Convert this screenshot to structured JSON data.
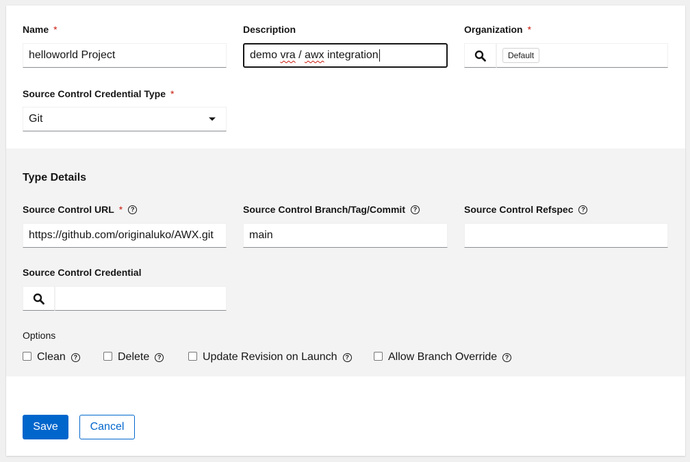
{
  "form": {
    "name": {
      "label": "Name",
      "required": "*",
      "value": "helloworld Project"
    },
    "description": {
      "label": "Description",
      "value_parts": [
        "demo ",
        "vra",
        " / ",
        "awx",
        " integration"
      ]
    },
    "organization": {
      "label": "Organization",
      "required": "*",
      "chip": "Default"
    },
    "credential_type": {
      "label": "Source Control Credential Type",
      "required": "*",
      "value": "Git"
    }
  },
  "type_details": {
    "title": "Type Details",
    "url": {
      "label": "Source Control URL",
      "required": "*",
      "value": "https://github.com/originaluko/AWX.git"
    },
    "branch": {
      "label": "Source Control Branch/Tag/Commit",
      "value": "main"
    },
    "refspec": {
      "label": "Source Control Refspec",
      "value": ""
    },
    "credential": {
      "label": "Source Control Credential",
      "value": ""
    },
    "options": {
      "label": "Options",
      "items": [
        {
          "label": "Clean",
          "checked": false
        },
        {
          "label": "Delete",
          "checked": false
        },
        {
          "label": "Update Revision on Launch",
          "checked": false
        },
        {
          "label": "Allow Branch Override",
          "checked": false
        }
      ]
    }
  },
  "help_glyph": "?",
  "actions": {
    "save": "Save",
    "cancel": "Cancel"
  },
  "icons": {
    "search": "search-icon",
    "dropdown": "caret-down-icon",
    "help": "question-circle-icon"
  },
  "colors": {
    "primary": "#0066cc",
    "required": "#c9190b",
    "section_bg": "#f3f3f3"
  }
}
